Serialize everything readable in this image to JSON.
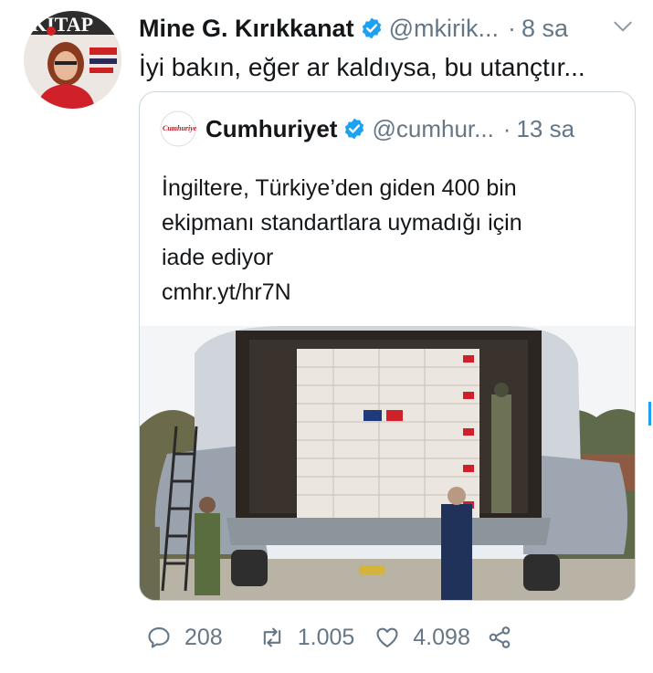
{
  "tweet": {
    "author_name": "Mine G. Kırıkkanat",
    "author_handle": "@mkirik...",
    "separator": "·",
    "time": "8 sa",
    "avatar_text": "KITAP",
    "text": "İyi bakın, eğer ar kaldıysa, bu utançtır..."
  },
  "quoted": {
    "author_name": "Cumhuriyet",
    "author_handle": "@cumhur...",
    "separator": "·",
    "time": "13 sa",
    "avatar_text": "Cumhuriyet",
    "lines": [
      "İngiltere, Türkiye’den giden 400 bin",
      "ekipmanı standartlara uymadığı için",
      "iade ediyor"
    ],
    "link": "cmhr.yt/hr7N"
  },
  "actions": {
    "replies": "208",
    "retweets": "1.005",
    "likes": "4.098"
  },
  "icons": {
    "verified": "verified-badge-icon",
    "chevron": "chevron-down-icon",
    "reply": "reply-icon",
    "retweet": "retweet-icon",
    "like": "heart-icon",
    "share": "share-icon"
  },
  "colors": {
    "verified": "#1da1f2",
    "secondary_text": "#657786",
    "border": "#ccd6dd"
  }
}
